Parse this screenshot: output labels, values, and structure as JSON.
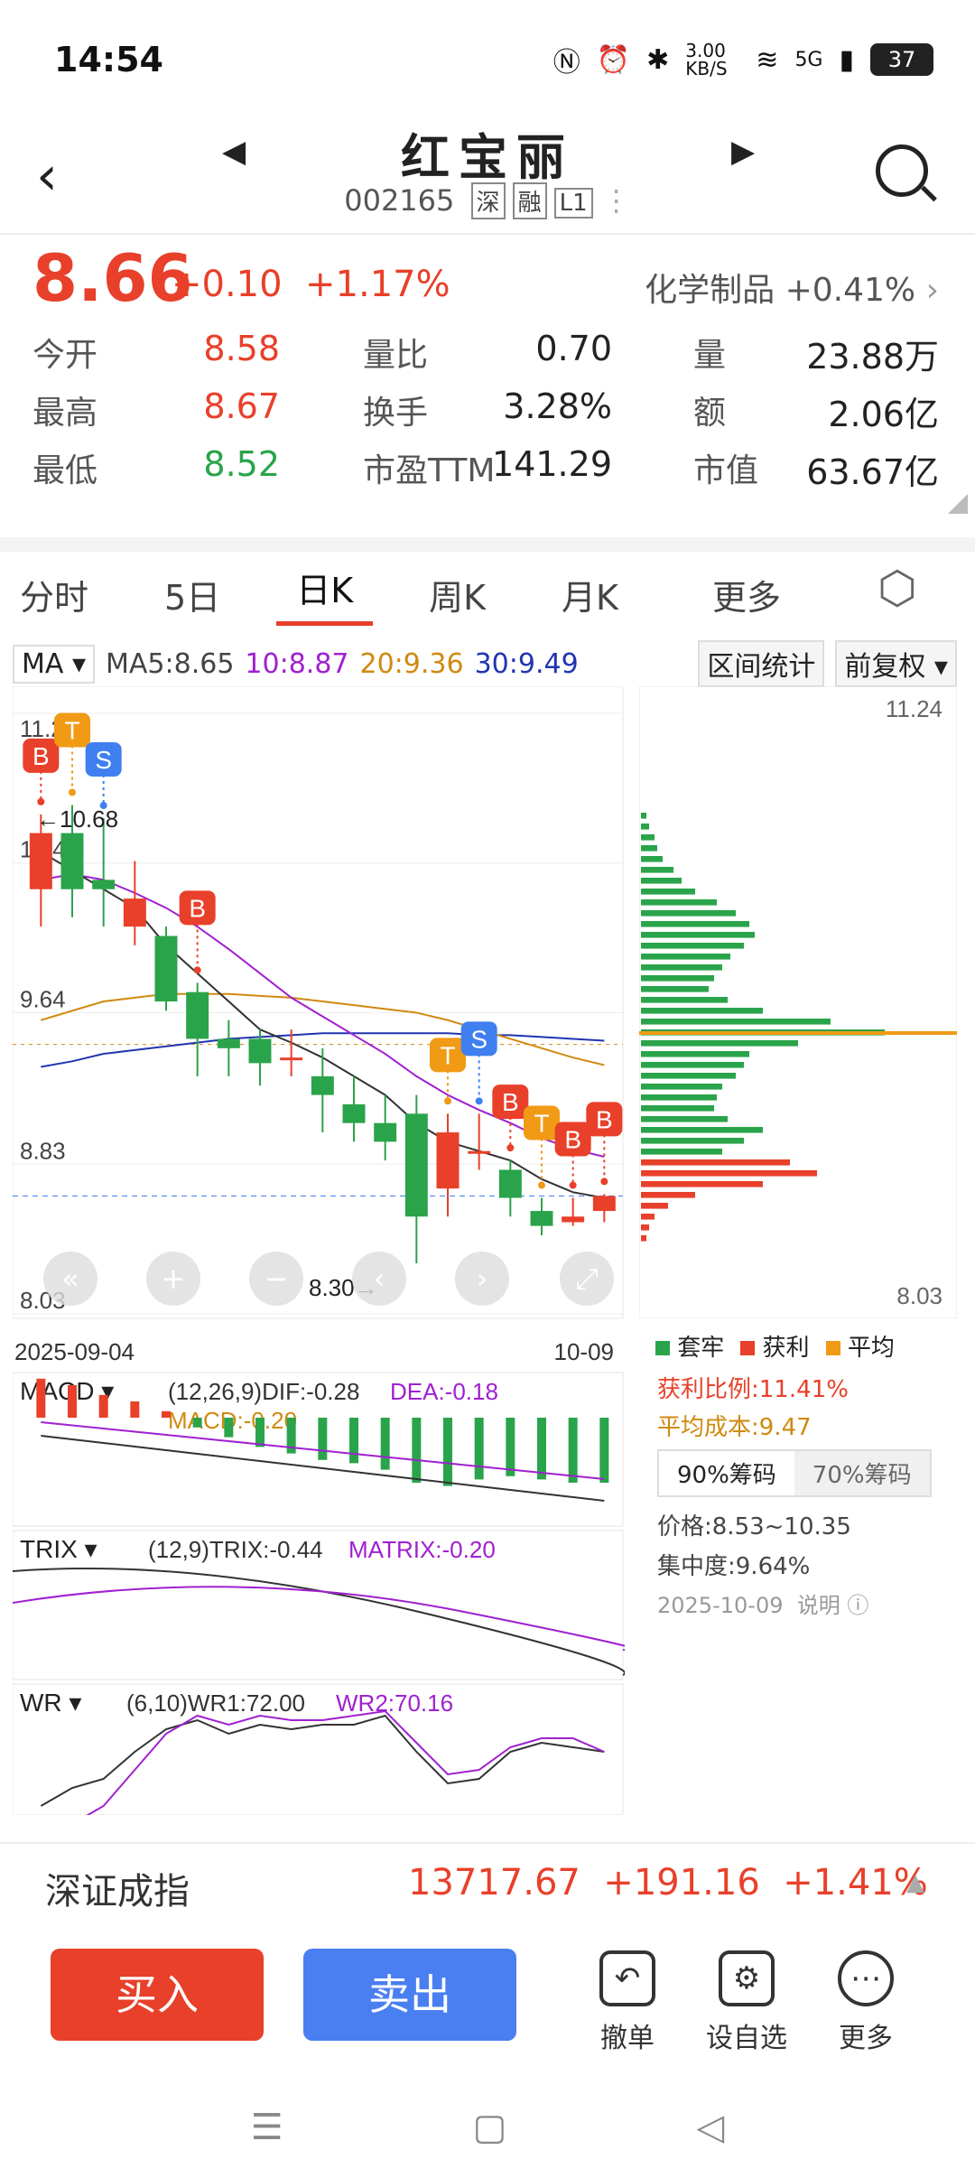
{
  "status": {
    "time": "14:54",
    "net_speed": "3.00 KB/S",
    "battery": "37",
    "signal": "5G"
  },
  "header": {
    "title": "红宝丽",
    "code": "002165",
    "tags": [
      "深",
      "融",
      "L1"
    ]
  },
  "quote": {
    "price": "8.66",
    "change": "+0.10",
    "change_pct": "+1.17%",
    "sector": "化学制品",
    "sector_pct": "+0.41%",
    "stats": [
      {
        "label": "今开",
        "value": "8.58",
        "color": "red"
      },
      {
        "label": "量比",
        "value": "0.70"
      },
      {
        "label": "量",
        "value": "23.88万"
      },
      {
        "label": "最高",
        "value": "8.67",
        "color": "red"
      },
      {
        "label": "换手",
        "value": "3.28%"
      },
      {
        "label": "额",
        "value": "2.06亿"
      },
      {
        "label": "最低",
        "value": "8.52",
        "color": "green"
      },
      {
        "label": "市盈TTM",
        "value": "141.29"
      },
      {
        "label": "市值",
        "value": "63.67亿"
      }
    ]
  },
  "tabs": [
    "分时",
    "5日",
    "日K",
    "周K",
    "月K",
    "更多"
  ],
  "active_tab": "日K",
  "indicator_bar": {
    "ma_select": "MA",
    "ma5": "MA5:8.65",
    "ma10": "10:8.87",
    "ma20": "20:9.36",
    "ma30": "30:9.49",
    "range_btn": "区间统计",
    "adjust_btn": "前复权"
  },
  "chart_data": {
    "type": "candlestick",
    "ylim": [
      8.03,
      11.24
    ],
    "y_ticks": [
      "11.24",
      "10.44",
      "9.64",
      "8.83",
      "8.03"
    ],
    "x_start": "2025-09-04",
    "x_end": "10-09",
    "annotations": {
      "high": "←10.68",
      "low": "8.30→"
    },
    "candles": [
      {
        "o": 10.3,
        "c": 10.6,
        "h": 10.7,
        "l": 10.1
      },
      {
        "o": 10.6,
        "c": 10.3,
        "h": 10.75,
        "l": 10.15
      },
      {
        "o": 10.35,
        "c": 10.3,
        "h": 10.68,
        "l": 10.1
      },
      {
        "o": 10.1,
        "c": 10.25,
        "h": 10.45,
        "l": 10.0
      },
      {
        "o": 10.05,
        "c": 9.7,
        "h": 10.1,
        "l": 9.65
      },
      {
        "o": 9.75,
        "c": 9.5,
        "h": 9.8,
        "l": 9.3
      },
      {
        "o": 9.5,
        "c": 9.45,
        "h": 9.6,
        "l": 9.3
      },
      {
        "o": 9.5,
        "c": 9.37,
        "h": 9.55,
        "l": 9.25
      },
      {
        "o": 9.4,
        "c": 9.4,
        "h": 9.55,
        "l": 9.3
      },
      {
        "o": 9.3,
        "c": 9.2,
        "h": 9.45,
        "l": 9.0
      },
      {
        "o": 9.15,
        "c": 9.05,
        "h": 9.3,
        "l": 8.95
      },
      {
        "o": 9.05,
        "c": 8.95,
        "h": 9.2,
        "l": 8.85
      },
      {
        "o": 9.1,
        "c": 8.55,
        "h": 9.2,
        "l": 8.3
      },
      {
        "o": 8.7,
        "c": 9.0,
        "h": 9.1,
        "l": 8.55
      },
      {
        "o": 8.9,
        "c": 8.9,
        "h": 9.1,
        "l": 8.8
      },
      {
        "o": 8.8,
        "c": 8.65,
        "h": 8.85,
        "l": 8.55
      },
      {
        "o": 8.58,
        "c": 8.5,
        "h": 8.65,
        "l": 8.45
      },
      {
        "o": 8.52,
        "c": 8.55,
        "h": 8.65,
        "l": 8.5
      },
      {
        "o": 8.58,
        "c": 8.66,
        "h": 8.67,
        "l": 8.52
      }
    ],
    "ma5": [
      10.5,
      10.4,
      10.3,
      10.2,
      10.0,
      9.85,
      9.7,
      9.55,
      9.48,
      9.4,
      9.3,
      9.2,
      9.05,
      8.95,
      8.9,
      8.85,
      8.75,
      8.68,
      8.65
    ],
    "ma10": [
      10.35,
      10.38,
      10.35,
      10.28,
      10.2,
      10.1,
      9.98,
      9.85,
      9.72,
      9.62,
      9.52,
      9.42,
      9.3,
      9.2,
      9.12,
      9.05,
      8.97,
      8.91,
      8.87
    ],
    "ma20": [
      9.6,
      9.65,
      9.7,
      9.72,
      9.74,
      9.74,
      9.74,
      9.73,
      9.72,
      9.7,
      9.68,
      9.66,
      9.64,
      9.6,
      9.55,
      9.5,
      9.45,
      9.4,
      9.36
    ],
    "ma30": [
      9.35,
      9.38,
      9.42,
      9.44,
      9.46,
      9.48,
      9.5,
      9.51,
      9.52,
      9.53,
      9.53,
      9.53,
      9.53,
      9.53,
      9.52,
      9.52,
      9.51,
      9.5,
      9.49
    ],
    "signals": [
      {
        "i": 0,
        "label": "B",
        "color": "#e8402a"
      },
      {
        "i": 1,
        "label": "T",
        "color": "#f09a16"
      },
      {
        "i": 2,
        "label": "S",
        "color": "#3f7ff0"
      },
      {
        "i": 5,
        "label": "B",
        "color": "#e8402a"
      },
      {
        "i": 13,
        "label": "T",
        "color": "#f09a16"
      },
      {
        "i": 14,
        "label": "S",
        "color": "#3f7ff0"
      },
      {
        "i": 15,
        "label": "B",
        "color": "#e8402a"
      },
      {
        "i": 16,
        "label": "T",
        "color": "#f09a16"
      },
      {
        "i": 17,
        "label": "B",
        "color": "#e8402a"
      },
      {
        "i": 18,
        "label": "B",
        "color": "#e8402a"
      }
    ],
    "macd": {
      "label": "(12,26,9)DIF:-0.28",
      "dea_label": "DEA:-0.18",
      "macd_label": "MACD:-0.20",
      "bars": [
        0.12,
        0.1,
        0.07,
        0.05,
        0.02,
        -0.03,
        -0.06,
        -0.09,
        -0.11,
        -0.13,
        -0.14,
        -0.16,
        -0.2,
        -0.21,
        -0.19,
        -0.18,
        -0.19,
        -0.2,
        -0.2
      ]
    },
    "trix": {
      "label": "(12,9)TRIX:-0.44",
      "matrix_label": "MATRIX:-0.20"
    },
    "wr": {
      "label": "(6,10)WR1:72.00",
      "wr2_label": "WR2:70.16"
    }
  },
  "chip": {
    "top": "11.24",
    "bottom": "8.03",
    "legend": [
      "套牢",
      "获利",
      "平均"
    ],
    "profit_ratio": "获利比例:11.41%",
    "avg_cost": "平均成本:9.47",
    "tabs": [
      "90%筹码",
      "70%筹码"
    ],
    "price_range": "价格:8.53~10.35",
    "concentration": "集中度:9.64%",
    "date": "2025-10-09",
    "note": "说明",
    "bars": [
      0.02,
      0.03,
      0.05,
      0.06,
      0.08,
      0.12,
      0.15,
      0.2,
      0.28,
      0.35,
      0.4,
      0.42,
      0.38,
      0.33,
      0.3,
      0.27,
      0.25,
      0.32,
      0.45,
      0.7,
      0.9,
      0.58,
      0.4,
      0.38,
      0.35,
      0.3,
      0.28,
      0.27,
      0.32,
      0.45,
      0.38,
      0.3,
      0.55,
      0.65,
      0.45,
      0.2,
      0.1,
      0.05,
      0.03,
      0.02
    ]
  },
  "index": {
    "name": "深证成指",
    "value": "13717.67",
    "change": "+191.16",
    "pct": "+1.41%"
  },
  "actions": {
    "buy": "买入",
    "sell": "卖出",
    "cancel": "撤单",
    "watch": "设自选",
    "more": "更多"
  }
}
